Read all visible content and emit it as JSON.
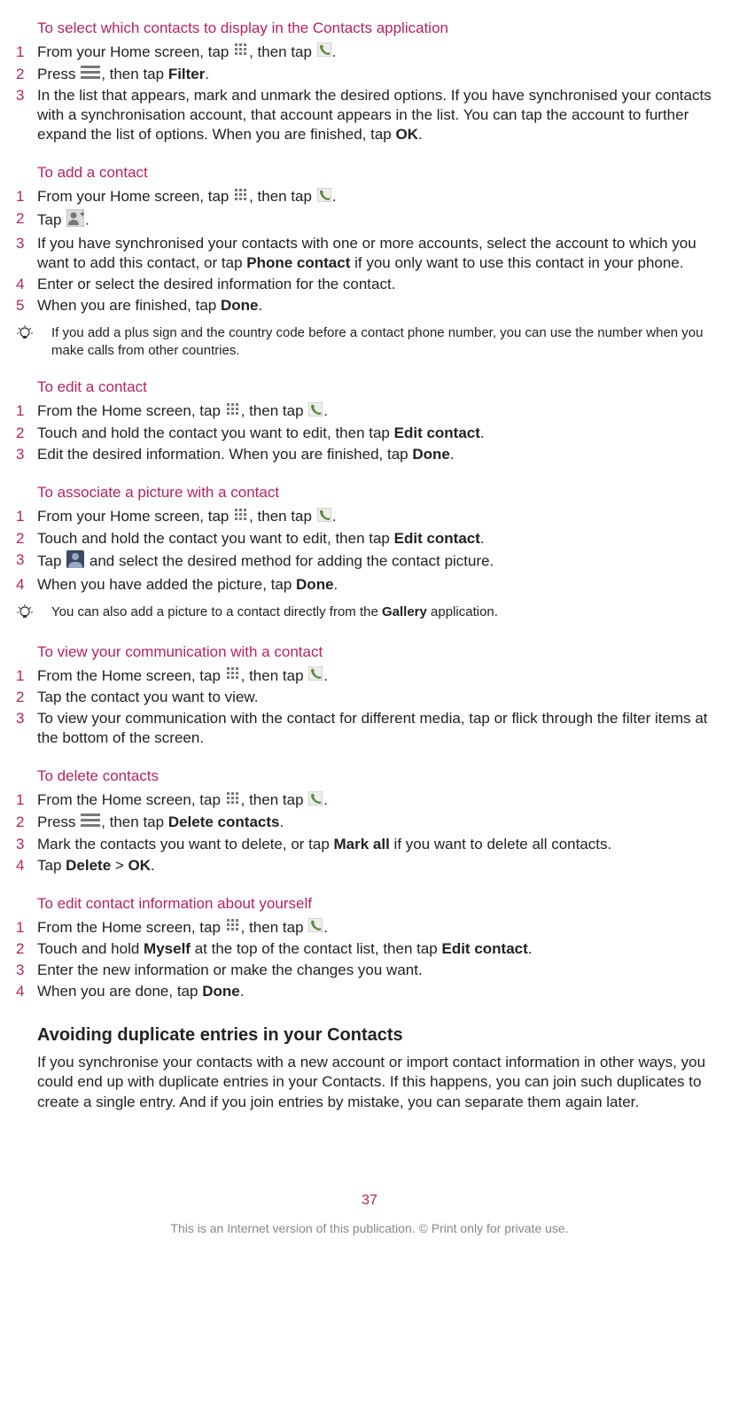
{
  "sections": {
    "s1": {
      "heading": "To select which contacts to display in the Contacts application",
      "steps": [
        {
          "n": "1",
          "parts": [
            "From your Home screen, tap ",
            "@grid-icon",
            ", then tap ",
            "@phone-icon",
            "."
          ]
        },
        {
          "n": "2",
          "parts": [
            "Press ",
            "@menu-icon",
            ", then tap ",
            "*Filter",
            "."
          ]
        },
        {
          "n": "3",
          "parts": [
            "In the list that appears, mark and unmark the desired options. If you have synchronised your contacts with a synchronisation account, that account appears in the list. You can tap the account to further expand the list of options. When you are finished, tap ",
            "*OK",
            "."
          ]
        }
      ]
    },
    "s2": {
      "heading": "To add a contact",
      "steps": [
        {
          "n": "1",
          "parts": [
            "From your Home screen, tap ",
            "@grid-icon",
            ", then tap ",
            "@phone-icon",
            "."
          ]
        },
        {
          "n": "2",
          "parts": [
            "Tap ",
            "@add-contact-icon",
            "."
          ]
        },
        {
          "n": "3",
          "parts": [
            "If you have synchronised your contacts with one or more accounts, select the account to which you want to add this contact, or tap ",
            "*Phone contact",
            " if you only want to use this contact in your phone."
          ]
        },
        {
          "n": "4",
          "parts": [
            "Enter or select the desired information for the contact."
          ]
        },
        {
          "n": "5",
          "parts": [
            "When you are finished, tap ",
            "*Done",
            "."
          ]
        }
      ],
      "tip": {
        "parts": [
          "If you add a plus sign and the country code before a contact phone number, you can use the number when you make calls from other countries."
        ]
      }
    },
    "s3": {
      "heading": "To edit a contact",
      "steps": [
        {
          "n": "1",
          "parts": [
            "From the Home screen, tap ",
            "@grid-icon",
            ", then tap ",
            "@phone-icon",
            "."
          ]
        },
        {
          "n": "2",
          "parts": [
            "Touch and hold the contact you want to edit, then tap ",
            "*Edit contact",
            "."
          ]
        },
        {
          "n": "3",
          "parts": [
            "Edit the desired information. When you are finished, tap ",
            "*Done",
            "."
          ]
        }
      ]
    },
    "s4": {
      "heading": "To associate a picture with a contact",
      "steps": [
        {
          "n": "1",
          "parts": [
            "From your Home screen, tap ",
            "@grid-icon",
            ", then tap ",
            "@phone-icon",
            "."
          ]
        },
        {
          "n": "2",
          "parts": [
            "Touch and hold the contact you want to edit, then tap ",
            "*Edit contact",
            "."
          ]
        },
        {
          "n": "3",
          "parts": [
            "Tap ",
            "@silhouette-icon",
            " and select the desired method for adding the contact picture."
          ]
        },
        {
          "n": "4",
          "parts": [
            "When you have added the picture, tap ",
            "*Done",
            "."
          ]
        }
      ],
      "tip": {
        "parts": [
          "You can also add a picture to a contact directly from the ",
          "*Gallery",
          " application."
        ]
      }
    },
    "s5": {
      "heading": "To view your communication with a contact",
      "steps": [
        {
          "n": "1",
          "parts": [
            "From the Home screen, tap ",
            "@grid-icon",
            ", then tap ",
            "@phone-icon",
            "."
          ]
        },
        {
          "n": "2",
          "parts": [
            "Tap the contact you want to view."
          ]
        },
        {
          "n": "3",
          "parts": [
            "To view your communication with the contact for different media, tap or flick through the filter items at the bottom of the screen."
          ]
        }
      ]
    },
    "s6": {
      "heading": "To delete contacts",
      "steps": [
        {
          "n": "1",
          "parts": [
            "From the Home screen, tap ",
            "@grid-icon",
            ", then tap ",
            "@phone-icon",
            "."
          ]
        },
        {
          "n": "2",
          "parts": [
            "Press ",
            "@menu-icon",
            ", then tap ",
            "*Delete contacts",
            "."
          ]
        },
        {
          "n": "3",
          "parts": [
            "Mark the contacts you want to delete, or tap ",
            "*Mark all",
            " if you want to delete all contacts."
          ]
        },
        {
          "n": "4",
          "parts": [
            "Tap ",
            "*Delete",
            " > ",
            "*OK",
            "."
          ]
        }
      ]
    },
    "s7": {
      "heading": "To edit contact information about yourself",
      "steps": [
        {
          "n": "1",
          "parts": [
            "From the Home screen, tap ",
            "@grid-icon",
            ", then tap ",
            "@phone-icon",
            "."
          ]
        },
        {
          "n": "2",
          "parts": [
            "Touch and hold ",
            "*Myself",
            " at the top of the contact list, then tap ",
            "*Edit contact",
            "."
          ]
        },
        {
          "n": "3",
          "parts": [
            "Enter the new information or make the changes you want."
          ]
        },
        {
          "n": "4",
          "parts": [
            "When you are done, tap ",
            "*Done",
            "."
          ]
        }
      ]
    }
  },
  "body_heading": "Avoiding duplicate entries in your Contacts",
  "body_para": "If you synchronise your contacts with a new account or import contact information in other ways, you could end up with duplicate entries in your Contacts. If this happens, you can join such duplicates to create a single entry. And if you join entries by mistake, you can separate them again later.",
  "page_number": "37",
  "footer": "This is an Internet version of this publication. © Print only for private use."
}
